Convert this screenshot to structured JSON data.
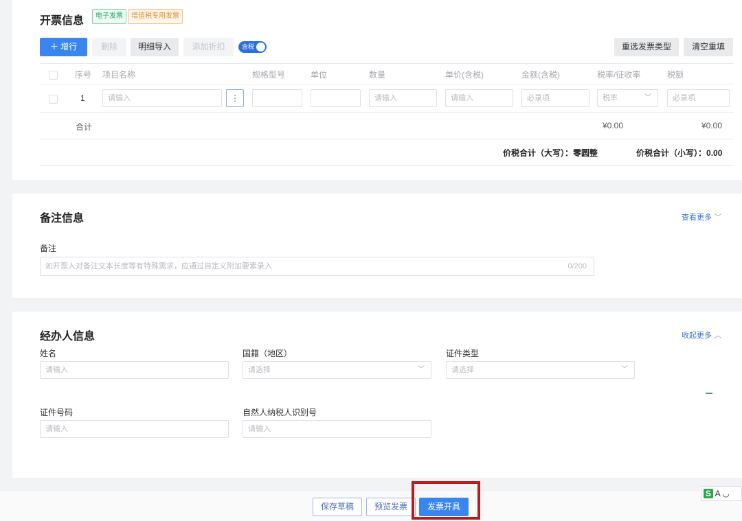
{
  "invoice": {
    "title": "开票信息",
    "tag_electronic": "电子发票",
    "tag_vat": "增值税专用发票",
    "btn_add_row": "增行",
    "btn_delete": "删除",
    "btn_import": "明细导入",
    "btn_discount": "添加折扣",
    "toggle_label": "含税",
    "btn_reselect_type": "重选发票类型",
    "btn_clear": "清空重填",
    "columns": [
      "序号",
      "项目名称",
      "规格型号",
      "单位",
      "数量",
      "单价(含税)",
      "金额(含税)",
      "税率/征收率",
      "税额"
    ],
    "row": {
      "index": "1",
      "name_placeholder": "请输入",
      "more_icon": "⋮",
      "qty_placeholder": "请输入",
      "price_placeholder": "请输入",
      "amount_placeholder": "必录项",
      "rate_placeholder": "税率",
      "tax_placeholder": "必录项"
    },
    "total_label": "合计",
    "total_amount": "¥0.00",
    "total_tax": "¥0.00",
    "sum_upper_label": "价税合计（大写）：",
    "sum_upper_value": "零圆整",
    "sum_lower_label": "价税合计（小写）：",
    "sum_lower_value": "0.00"
  },
  "remarks": {
    "title": "备注信息",
    "view_more": "查看更多",
    "field_label": "备注",
    "placeholder": "如开票人对备注文本长度等有特殊需求，应通过自定义附加要素录入",
    "counter": "0/200"
  },
  "agent": {
    "title": "经办人信息",
    "collapse": "收起更多",
    "name_label": "姓名",
    "name_placeholder": "请输入",
    "nationality_label": "国籍（地区）",
    "nationality_placeholder": "请选择",
    "id_type_label": "证件类型",
    "id_type_placeholder": "请选择",
    "id_number_label": "证件号码",
    "id_number_placeholder": "请输入",
    "taxpayer_id_label": "自然人纳税人识别号",
    "taxpayer_id_placeholder": "请输入"
  },
  "footer": {
    "save_draft": "保存草稿",
    "preview": "预览发票",
    "issue": "发票开具"
  },
  "colors": {
    "primary": "#3a86f0",
    "highlight": "#b21e1e"
  }
}
